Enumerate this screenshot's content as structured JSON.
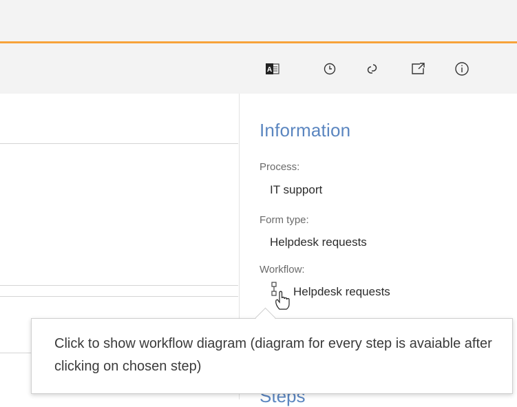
{
  "toolbar": {
    "icons": [
      "outlook-icon",
      "history-icon",
      "link-icon",
      "external-link-icon",
      "info-icon"
    ]
  },
  "info_panel": {
    "title": "Information",
    "process_label": "Process:",
    "process_value": "IT support",
    "form_type_label": "Form type:",
    "form_type_value": "Helpdesk requests",
    "workflow_label": "Workflow:",
    "workflow_value": "Helpdesk requests",
    "next_section_title": "Steps"
  },
  "tooltip": {
    "text": "Click to show workflow diagram (diagram for every step is avaiable after clicking on chosen step)"
  },
  "colors": {
    "accent": "#f7a23a",
    "heading": "#5b86c0",
    "toolbar_bg": "#f3f3f3"
  }
}
